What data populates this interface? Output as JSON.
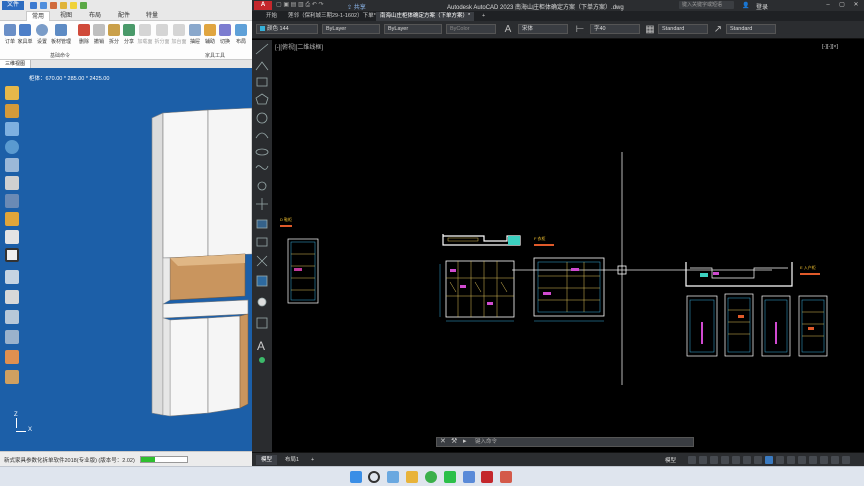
{
  "left_app": {
    "quick_access": {
      "file_tab": "文件",
      "tabs": [
        "常用",
        "视图",
        "布局",
        "配件",
        "特量"
      ],
      "active_tab": "常用"
    },
    "ribbon": {
      "buttons": [
        "订单",
        "家具单",
        "设置",
        "板材管理",
        "删除",
        "撤销",
        "拆分",
        "分享",
        "加载面",
        "拆分面",
        "加台面",
        "抽屉",
        "辅助",
        "编辑",
        "重置",
        "画图",
        "运行",
        "切换",
        "布局"
      ],
      "groups": [
        "基础命令",
        "家具工具"
      ]
    },
    "view_tab": "三维视图",
    "dimension_readout": "柜体：670.00 * 285.00 * 2425.00",
    "axis_x": "X",
    "axis_z": "Z",
    "status": {
      "text": "新式家具参数化拆单软件2018(专业版) (版本号：2.02)",
      "progress": 0.3
    }
  },
  "cad": {
    "logo": "A",
    "title": "Autodesk AutoCAD 2023    南海山庄柜体确定方案（下单方案）.dwg",
    "search_placeholder": "键入关键字或短语",
    "user": "登录",
    "share": "共享",
    "tabs": [
      "开始",
      "莲邻（保利城三期29-1-1602）下单*",
      "南海山庄柜体确定方案（下单方案）*"
    ],
    "active_tab": "南海山庄柜体确定方案（下单方案）*",
    "props": {
      "color": "颜色 144",
      "linetype": "ByLayer",
      "lineweight": "ByLayer",
      "plotstyle": "ByColor",
      "font": "宋体",
      "text_height": "字40",
      "table_style": "Standard",
      "dim_style": "Standard"
    },
    "canvas_menu": "[-][俯视][二维线框]",
    "viewport_ctl": "[-][-][×]",
    "command_placeholder": "键入命令",
    "layout_tabs": [
      "模型",
      "布局1"
    ],
    "active_layout": "模型",
    "status_model": "模型",
    "drawing_labels": {
      "left": "D 鞋柜",
      "middle": "F 衣柜",
      "right": "E 入户柜"
    }
  },
  "colors": {
    "cad_bg": "#000000",
    "viewport_blue": "#1c5fa8",
    "accent_blue": "#2d6cc0",
    "cad_red": "#c4272c"
  }
}
